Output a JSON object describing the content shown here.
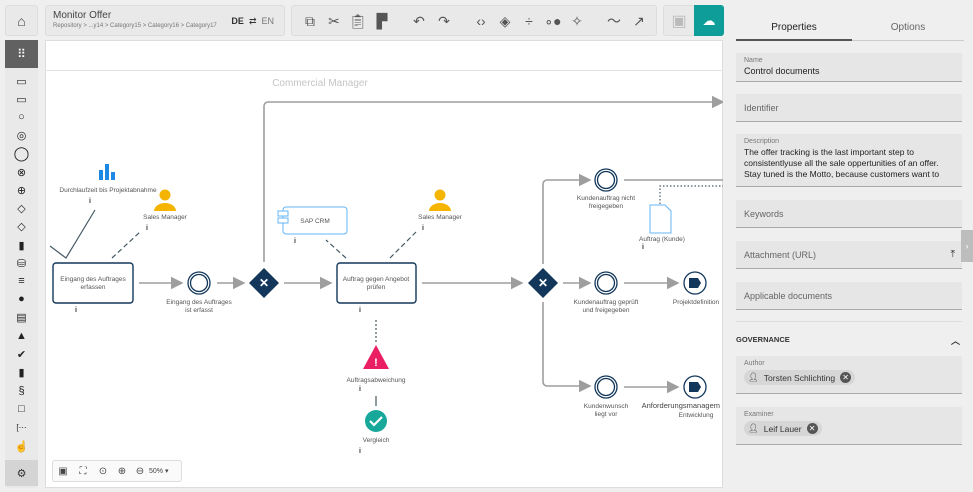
{
  "header": {
    "title": "Monitor Offer",
    "breadcrumb": "Repository > ...y14 > Category15 >  Category16 > Category17",
    "lang_from": "DE",
    "lang_to": "EN"
  },
  "canvas": {
    "lane_label": "Commercial Manager",
    "zoom": "50%"
  },
  "nodes": {
    "kpi": "Durchlaufzeit bis Projektabnahme",
    "role1": "Sales Manager",
    "role2": "Sales Manager",
    "system": "SAP CRM",
    "task1": [
      "Eingang des Auftrages",
      "erfassen"
    ],
    "event1": [
      "Eingang des Auftrages",
      "ist erfasst"
    ],
    "task2": [
      "Auftrag gegen Angebot",
      "prüfen"
    ],
    "risk": "Auftragsabweichung",
    "control": "Vergleich",
    "event2": [
      "Kundenauftrag nicht",
      "freigegeben"
    ],
    "doc": "Auftrag (Kunde)",
    "event3": [
      "Kundenauftrag geprüft",
      "und freigegeben"
    ],
    "end1": "Projektdefinition",
    "event4": [
      "Kundenwunsch",
      "liegt vor"
    ],
    "end2": [
      "Anforderungsmanagem",
      "Entwicklung"
    ]
  },
  "panel": {
    "tabs": [
      "Properties",
      "Options"
    ],
    "active_tab": "Properties",
    "name_label": "Name",
    "name_value": "Control documents",
    "identifier_placeholder": "Identifier",
    "description_label": "Description",
    "description_value": "The offer tracking is the last important step to consistentlyuse all the sale oppertunities of an offer. Stay tuned is the Motto, because customers want to be more",
    "keywords_placeholder": "Keywords",
    "attachment_placeholder": "Attachment (URL)",
    "applicable_placeholder": "Applicable documents",
    "governance": "GOVERNANCE",
    "author_label": "Author",
    "author": "Torsten Schlichting",
    "examiner_label": "Examiner",
    "examiner": "Leif Lauer"
  },
  "colors": {
    "accent": "#0f9d9a",
    "navy": "#13375a",
    "kpi": "#1e88e5",
    "role": "#f5b400",
    "risk": "#e91e63",
    "control": "#17a89a"
  }
}
